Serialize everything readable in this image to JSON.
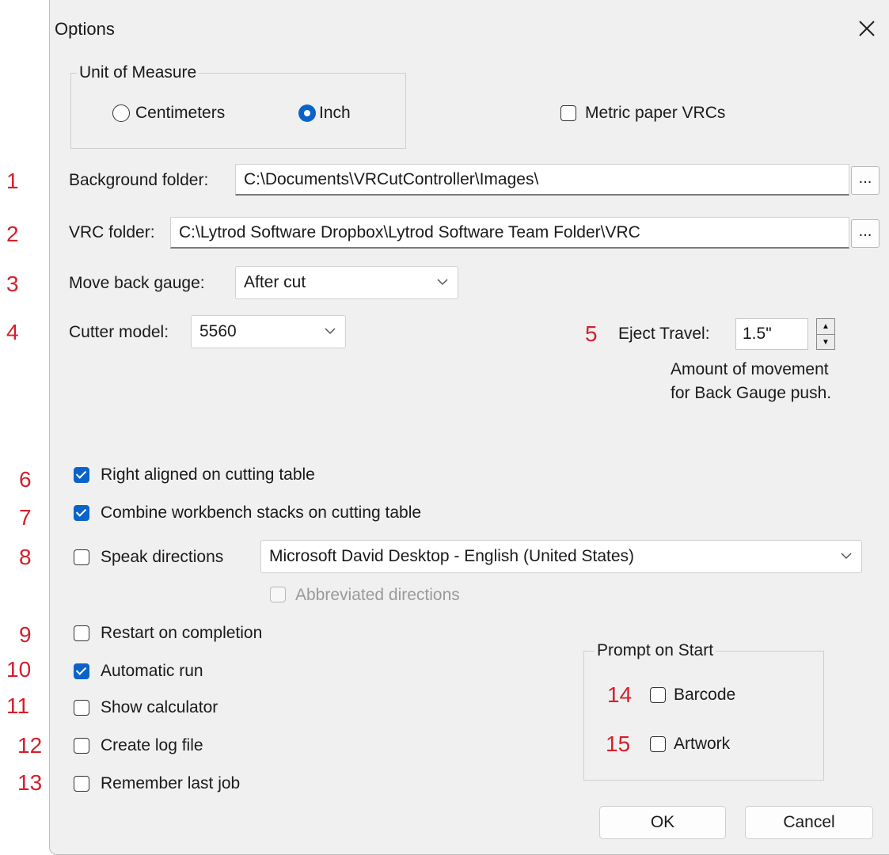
{
  "window": {
    "title": "Options",
    "close_glyph": "✕"
  },
  "annotations": [
    "1",
    "2",
    "3",
    "4",
    "5",
    "6",
    "7",
    "8",
    "9",
    "10",
    "11",
    "12",
    "13",
    "14",
    "15"
  ],
  "unit_of_measure": {
    "legend": "Unit of Measure",
    "centimeters_label": "Centimeters",
    "inch_label": "Inch",
    "selected": "Inch"
  },
  "metric_paper": {
    "label": "Metric paper VRCs",
    "checked": false
  },
  "background_folder": {
    "label": "Background folder:",
    "value": "C:\\Documents\\VRCutController\\Images\\",
    "browse_label": "..."
  },
  "vrc_folder": {
    "label": "VRC folder:",
    "value": "C:\\Lytrod Software Dropbox\\Lytrod Software Team Folder\\VRC",
    "browse_label": "..."
  },
  "move_back_gauge": {
    "label": "Move back gauge:",
    "value": "After cut"
  },
  "cutter_model": {
    "label": "Cutter model:",
    "value": "5560"
  },
  "eject_travel": {
    "label": "Eject Travel:",
    "value": "1.5\"",
    "help_line1": "Amount of movement",
    "help_line2": "for Back Gauge push."
  },
  "options": {
    "right_aligned": {
      "label": "Right aligned on cutting table",
      "checked": true
    },
    "combine_stacks": {
      "label": "Combine workbench stacks on cutting table",
      "checked": true
    },
    "speak_directions": {
      "label": "Speak directions",
      "checked": false
    },
    "voice": {
      "value": "Microsoft David Desktop - English (United States)"
    },
    "abbreviated": {
      "label": "Abbreviated directions",
      "checked": false,
      "disabled": true
    },
    "restart": {
      "label": "Restart on completion",
      "checked": false
    },
    "automatic_run": {
      "label": "Automatic run",
      "checked": true
    },
    "show_calculator": {
      "label": "Show calculator",
      "checked": false
    },
    "create_log": {
      "label": "Create log file",
      "checked": false
    },
    "remember_job": {
      "label": "Remember last job",
      "checked": false
    }
  },
  "prompt_on_start": {
    "legend": "Prompt on Start",
    "barcode": {
      "label": "Barcode",
      "checked": false
    },
    "artwork": {
      "label": "Artwork",
      "checked": false
    }
  },
  "buttons": {
    "ok": "OK",
    "cancel": "Cancel"
  },
  "colors": {
    "accent": "#0a63c9",
    "annotation": "#d4202b",
    "dialog_bg": "#f0f0f0"
  }
}
